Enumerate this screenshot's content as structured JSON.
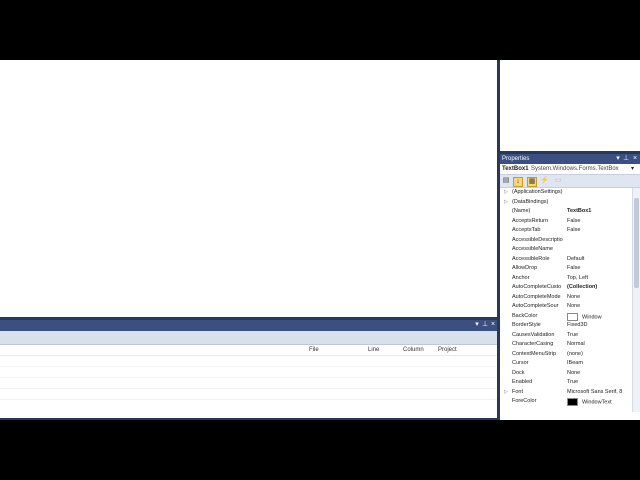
{
  "error_list": {
    "columns": [
      "File",
      "Line",
      "Column",
      "Project"
    ],
    "close_glyph": "×",
    "pin_glyph": "⊥",
    "dropdown_glyph": "▾"
  },
  "properties": {
    "title": "Properties",
    "object_name": "TextBox1",
    "object_type": "System.Windows.Forms.TextBox",
    "dropdown_glyph": "▾",
    "close_glyph": "×",
    "pin_glyph": "⊥",
    "toolbar": {
      "categorized_glyph": "▤",
      "alphabetical_glyph": "↓",
      "properties_glyph": "▦",
      "events_glyph": "⚡",
      "pages_glyph": "▭"
    },
    "rows": [
      {
        "name": "(ApplicationSettings)",
        "value": "",
        "expandable": true
      },
      {
        "name": "(DataBindings)",
        "value": "",
        "expandable": true
      },
      {
        "name": "(Name)",
        "value": "TextBox1",
        "bold": true
      },
      {
        "name": "AcceptsReturn",
        "value": "False"
      },
      {
        "name": "AcceptsTab",
        "value": "False"
      },
      {
        "name": "AccessibleDescriptio",
        "value": ""
      },
      {
        "name": "AccessibleName",
        "value": ""
      },
      {
        "name": "AccessibleRole",
        "value": "Default"
      },
      {
        "name": "AllowDrop",
        "value": "False"
      },
      {
        "name": "Anchor",
        "value": "Top, Left"
      },
      {
        "name": "AutoCompleteCusto",
        "value": "(Collection)",
        "bold": true
      },
      {
        "name": "AutoCompleteMode",
        "value": "None"
      },
      {
        "name": "AutoCompleteSour",
        "value": "None"
      },
      {
        "name": "BackColor",
        "value": "Window",
        "swatch": "#ffffff"
      },
      {
        "name": "BorderStyle",
        "value": "Fixed3D"
      },
      {
        "name": "CausesValidation",
        "value": "True"
      },
      {
        "name": "CharacterCasing",
        "value": "Normal"
      },
      {
        "name": "ContextMenuStrip",
        "value": "(none)"
      },
      {
        "name": "Cursor",
        "value": "IBeam"
      },
      {
        "name": "Dock",
        "value": "None"
      },
      {
        "name": "Enabled",
        "value": "True"
      },
      {
        "name": "Font",
        "value": "Microsoft Sans Serif, 8",
        "expandable": true
      },
      {
        "name": "ForeColor",
        "value": "WindowText",
        "swatch": "#000000"
      }
    ]
  }
}
